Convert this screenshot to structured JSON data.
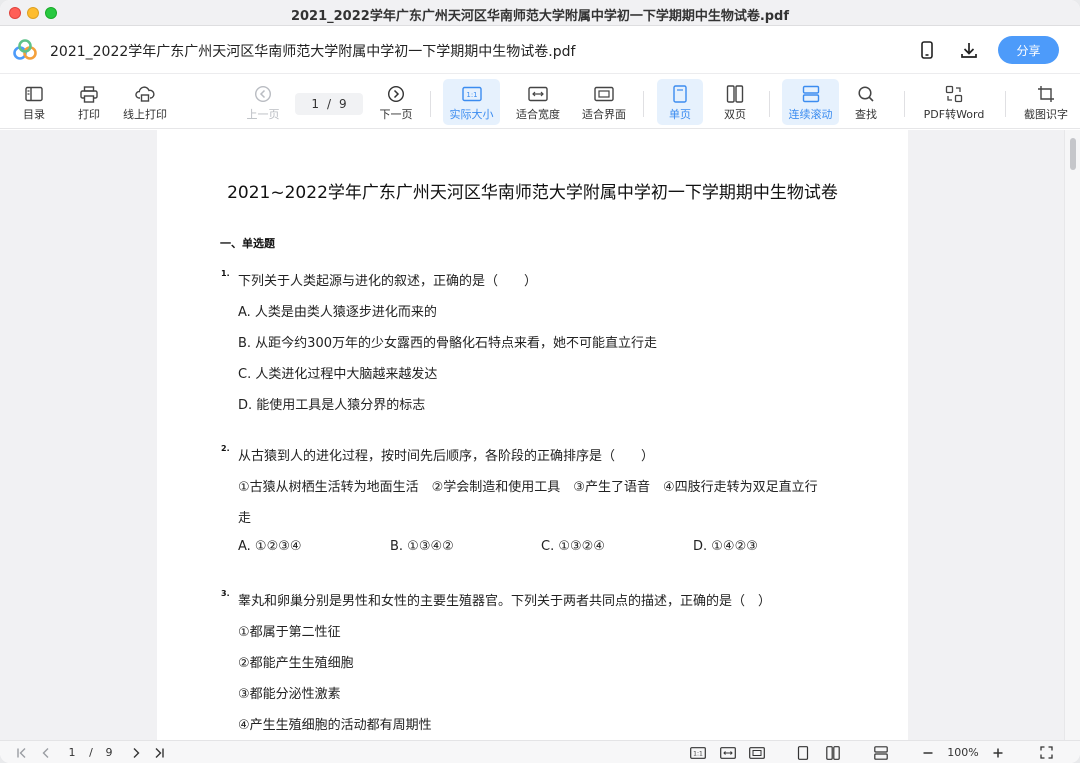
{
  "window": {
    "title": "2021_2022学年广东广州天河区华南师范大学附属中学初一下学期期中生物试卷.pdf"
  },
  "header": {
    "file_name": "2021_2022学年广东广州天河区华南师范大学附属中学初一下学期期中生物试卷.pdf",
    "share_label": "分享"
  },
  "toolbar": {
    "toc": "目录",
    "print": "打印",
    "online_print": "线上打印",
    "prev": "上一页",
    "current_page": "1",
    "page_sep": "/",
    "total_pages": "9",
    "next": "下一页",
    "actual_size": "实际大小",
    "fit_width": "适合宽度",
    "fit_page": "适合界面",
    "single_page": "单页",
    "double_page": "双页",
    "continuous": "连续滚动",
    "find": "查找",
    "pdf_to_word": "PDF转Word",
    "ocr": "截图识字"
  },
  "document": {
    "title": "2021~2022学年广东广州天河区华南师范大学附属中学初一下学期期中生物试卷",
    "section": "一、单选题",
    "q1": {
      "num": "1.",
      "stem": "下列关于人类起源与进化的叙述，正确的是（　　）",
      "a": "A. 人类是由类人猿逐步进化而来的",
      "b": "B. 从距今约300万年的少女露西的骨骼化石特点来看，她不可能直立行走",
      "c": "C. 人类进化过程中大脑越来越发达",
      "d": "D. 能使用工具是人猿分界的标志"
    },
    "q2": {
      "num": "2.",
      "stem": "从古猿到人的进化过程，按时间先后顺序，各阶段的正确排序是（　　）",
      "line2": "①古猿从树栖生活转为地面生活　②学会制造和使用工具　③产生了语音　④四肢行走转为双足直立行",
      "line3": "走",
      "a": "A. ①②③④",
      "b": "B. ①③④②",
      "c": "C. ①③②④",
      "d": "D. ①④②③"
    },
    "q3": {
      "num": "3.",
      "stem": "睾丸和卵巢分别是男性和女性的主要生殖器官。下列关于两者共同点的描述，正确的是（　）",
      "i1": "①都属于第二性征",
      "i2": "②都能产生生殖细胞",
      "i3": "③都能分泌性激素",
      "i4": "④产生生殖细胞的活动都有周期性"
    }
  },
  "statusbar": {
    "current_page": "1",
    "sep": "/",
    "total_pages": "9",
    "zoom": "100%"
  },
  "colors": {
    "accent": "#4d9bfa",
    "active_bg": "#e6f1fd",
    "active_text": "#3b8cf0"
  }
}
